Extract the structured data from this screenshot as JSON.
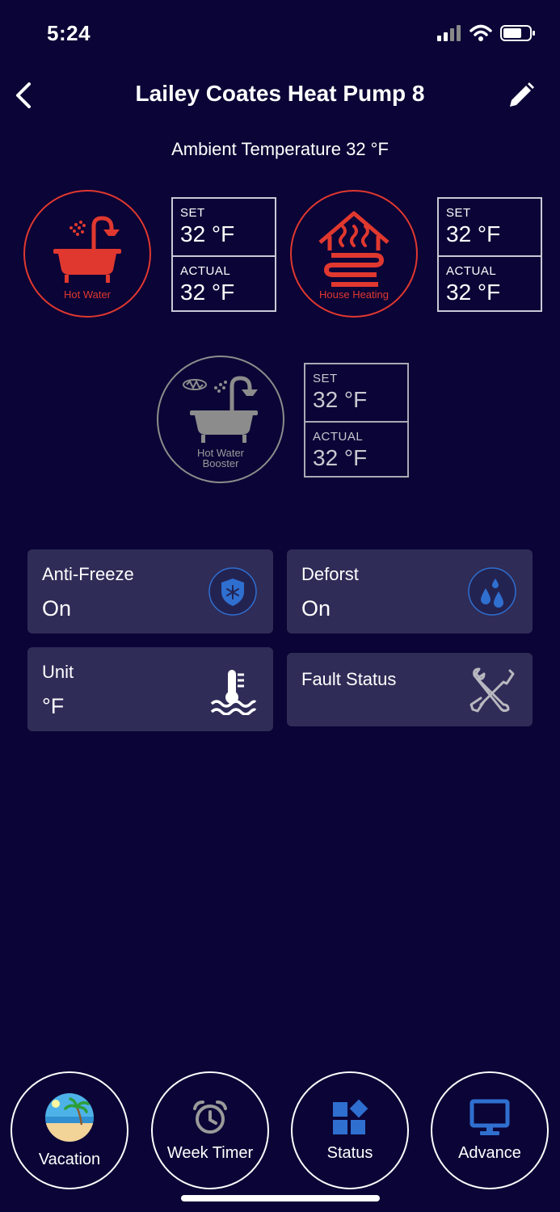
{
  "status_bar": {
    "time": "5:24"
  },
  "header": {
    "title": "Lailey Coates Heat Pump 8"
  },
  "ambient": {
    "text": "Ambient Temperature 32 °F"
  },
  "modes": [
    {
      "label": "Hot Water",
      "set_caption": "SET",
      "set_value": "32 °F",
      "actual_caption": "ACTUAL",
      "actual_value": "32 °F",
      "icon": "bathtub-shower-icon",
      "color": "#e0382f"
    },
    {
      "label": "House Heating",
      "set_caption": "SET",
      "set_value": "32 °F",
      "actual_caption": "ACTUAL",
      "actual_value": "32 °F",
      "icon": "house-heating-icon",
      "color": "#e0382f"
    },
    {
      "label_line1": "Hot Water",
      "label_line2": "Booster",
      "set_caption": "SET",
      "set_value": "32 °F",
      "actual_caption": "ACTUAL",
      "actual_value": "32 °F",
      "icon": "bathtub-booster-icon",
      "color": "#8c8c8c"
    }
  ],
  "cards": {
    "anti_freeze": {
      "label": "Anti-Freeze",
      "value": "On",
      "icon": "snowflake-shield-icon"
    },
    "defrost": {
      "label": "Deforst",
      "value": "On",
      "icon": "water-drops-icon"
    },
    "unit": {
      "label": "Unit",
      "value": "°F",
      "icon": "thermometer-water-icon"
    },
    "fault": {
      "label": "Fault Status",
      "icon": "tools-icon"
    }
  },
  "nav": {
    "vacation": "Vacation",
    "week_timer": "Week Timer",
    "status": "Status",
    "advance": "Advance"
  },
  "colors": {
    "background": "#0b0436",
    "card": "#2f2c57",
    "accent_red": "#e0382f",
    "accent_blue": "#2f6fd0"
  }
}
